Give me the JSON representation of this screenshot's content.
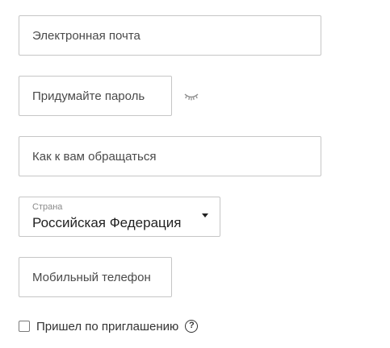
{
  "form": {
    "email": {
      "placeholder": "Электронная почта",
      "value": ""
    },
    "password": {
      "placeholder": "Придумайте пароль",
      "value": ""
    },
    "name": {
      "placeholder": "Как к вам обращаться",
      "value": ""
    },
    "country": {
      "label": "Страна",
      "selected": "Российская Федерация"
    },
    "phone": {
      "placeholder": "Мобильный телефон",
      "value": ""
    },
    "invited": {
      "label": "Пришел по приглашению",
      "checked": false,
      "help_glyph": "?"
    }
  },
  "icons": {
    "password_toggle": "eye-closed-icon",
    "country_dropdown": "caret-down-icon",
    "help": "question-circle-icon"
  },
  "colors": {
    "border": "#c6c6c6",
    "text": "#333333",
    "muted_label": "#8a8a8a"
  }
}
